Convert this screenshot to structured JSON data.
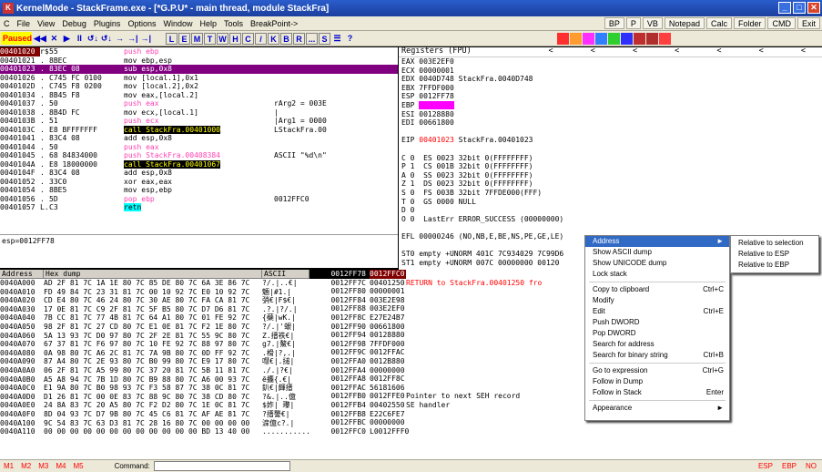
{
  "window": {
    "title": "KernelMode - StackFrame.exe - [*G.P.U* - main thread, module StackFra]",
    "min": "_",
    "max": "□",
    "close": "✕"
  },
  "menu": {
    "items": [
      "C",
      "File",
      "View",
      "Debug",
      "Plugins",
      "Options",
      "Window",
      "Help",
      "Tools",
      "BreakPoint->"
    ],
    "right": [
      "BP",
      "P",
      "VB",
      "Notepad",
      "Calc",
      "Folder",
      "CMD",
      "Exit"
    ]
  },
  "toolbar": {
    "status": "Paused",
    "buttons": [
      "◀◀",
      "✕",
      "▶",
      "II",
      "↺↓",
      "↺↓",
      "→",
      "→|",
      "→|"
    ],
    "letters": [
      "L",
      "E",
      "M",
      "T",
      "W",
      "H",
      "C",
      "/",
      "K",
      "B",
      "R",
      "...",
      "S"
    ],
    "extra": [
      "☰",
      "?"
    ]
  },
  "disasm": {
    "rows": [
      {
        "addr": "00401020",
        "mark": "r$",
        "bytes": "55",
        "instr": "push ebp",
        "kind": "push",
        "comment": ""
      },
      {
        "addr": "00401021",
        "mark": ".",
        "bytes": "8BEC",
        "instr": "mov ebp,esp",
        "kind": "mov",
        "comment": ""
      },
      {
        "addr": "00401023",
        "mark": ".",
        "bytes": "83EC 08",
        "instr": "sub esp,0x8",
        "kind": "cur",
        "comment": ""
      },
      {
        "addr": "00401026",
        "mark": ".",
        "bytes": "C745 FC 0100",
        "instr": "mov [local.1],0x1",
        "kind": "mov",
        "comment": ""
      },
      {
        "addr": "0040102D",
        "mark": ".",
        "bytes": "C745 F8 0200",
        "instr": "mov [local.2],0x2",
        "kind": "mov",
        "comment": ""
      },
      {
        "addr": "00401034",
        "mark": ".",
        "bytes": "8B45 F8",
        "instr": "mov eax,[local.2]",
        "kind": "mov",
        "comment": ""
      },
      {
        "addr": "00401037",
        "mark": ".",
        "bytes": "50",
        "instr": "push eax",
        "kind": "push",
        "comment": "rArg2 = 003E"
      },
      {
        "addr": "00401038",
        "mark": ".",
        "bytes": "8B4D FC",
        "instr": "mov ecx,[local.1]",
        "kind": "mov",
        "comment": "|"
      },
      {
        "addr": "0040103B",
        "mark": ".",
        "bytes": "51",
        "instr": "push ecx",
        "kind": "push",
        "comment": "|Arg1 = 0000"
      },
      {
        "addr": "0040103C",
        "mark": ".",
        "bytes": "E8 BFFFFFFF",
        "instr": "call StackFra.00401000",
        "kind": "call",
        "comment": "LStackFra.00"
      },
      {
        "addr": "00401041",
        "mark": ".",
        "bytes": "83C4 08",
        "instr": "add esp,0x8",
        "kind": "mov",
        "comment": ""
      },
      {
        "addr": "00401044",
        "mark": ".",
        "bytes": "50",
        "instr": "push eax",
        "kind": "push",
        "comment": ""
      },
      {
        "addr": "00401045",
        "mark": ".",
        "bytes": "68 84834000",
        "instr": "push StackFra.00408384",
        "kind": "push",
        "comment": "ASCII \"%d\\n\""
      },
      {
        "addr": "0040104A",
        "mark": ".",
        "bytes": "E8 18000000",
        "instr": "call StackFra.00401067",
        "kind": "call",
        "comment": ""
      },
      {
        "addr": "0040104F",
        "mark": ".",
        "bytes": "83C4 08",
        "instr": "add esp,0x8",
        "kind": "mov",
        "comment": ""
      },
      {
        "addr": "00401052",
        "mark": ".",
        "bytes": "33C0",
        "instr": "xor eax,eax",
        "kind": "mov",
        "comment": ""
      },
      {
        "addr": "00401054",
        "mark": ".",
        "bytes": "8BE5",
        "instr": "mov esp,ebp",
        "kind": "mov",
        "comment": ""
      },
      {
        "addr": "00401056",
        "mark": ".",
        "bytes": "5D",
        "instr": "pop ebp",
        "kind": "push",
        "comment": "0012FFC0"
      },
      {
        "addr": "00401057",
        "mark": "L.",
        "bytes": "C3",
        "instr": "retn",
        "kind": "ret",
        "comment": ""
      }
    ]
  },
  "esp_info": "esp=0012FF78",
  "registers": {
    "header": "Registers (FPU)",
    "arrows": "< < < < < < <",
    "rows": [
      {
        "t": "EAX 003E2EF0"
      },
      {
        "t": "ECX 00000001"
      },
      {
        "t": "EDX 0040D748 StackFra.0040D748"
      },
      {
        "t": "EBX 7FFDF000"
      },
      {
        "t": "ESP 0012FF78"
      },
      {
        "t": "EBP ",
        "hl": "0012FF78"
      },
      {
        "t": "ESI 00128880"
      },
      {
        "t": "EDI 00661800"
      },
      {
        "t": ""
      },
      {
        "t": "EIP ",
        "red": "00401023",
        "rest": " StackFra.00401023"
      },
      {
        "t": ""
      },
      {
        "t": "C 0  ES 0023 32bit 0(FFFFFFFF)"
      },
      {
        "t": "P 1  CS 001B 32bit 0(FFFFFFFF)"
      },
      {
        "t": "A 0  SS 0023 32bit 0(FFFFFFFF)"
      },
      {
        "t": "Z 1  DS 0023 32bit 0(FFFFFFFF)"
      },
      {
        "t": "S 0  FS 003B 32bit 7FFDE000(FFF)"
      },
      {
        "t": "T 0  GS 0000 NULL"
      },
      {
        "t": "D 0"
      },
      {
        "t": "O 0  LastErr ERROR_SUCCESS (00000000)"
      },
      {
        "t": ""
      },
      {
        "t": "EFL 00000246 (NO,NB,E,BE,NS,PE,GE,LE)"
      },
      {
        "t": ""
      },
      {
        "t": "ST0 empty +UNORM 401C 7C934029 7C99D6"
      },
      {
        "t": "ST1 empty +UNORM 007C 00000000 00120"
      }
    ]
  },
  "dump": {
    "headers": [
      "Address",
      "Hex dump",
      "ASCII"
    ],
    "rows": [
      {
        "a": "0040A000",
        "h": "AD 2F 81 7C 1A 1E 80 7C 85 DE 80 7C 6A 3E 86 7C",
        "s": "?/.|..€|"
      },
      {
        "a": "0040A010",
        "h": "FD 49 84 7C 23 31 81 7C 00 10 92 7C E0 10 92 7C",
        "s": "魎|#1.|"
      },
      {
        "a": "0040A020",
        "h": "CD E4 80 7C 46 24 80 7C 30 AE 80 7C FA CA 81 7C",
        "s": "弰€|F$€|"
      },
      {
        "a": "0040A030",
        "h": "17 0E 81 7C C9 2F 81 7C 5F B5 80 7C D7 D6 81 7C",
        "s": ".?.|?/.|"
      },
      {
        "a": "0040A040",
        "h": "7B CC 81 7C 77 4B 81 7C 64 A1 80 7C 01 FE 92 7C",
        "s": "{蘗|wK.|"
      },
      {
        "a": "0040A050",
        "h": "98 2F 81 7C 27 CD 80 7C E1 0E 81 7C F2 1E 80 7C",
        "s": "?/.|'蛝|"
      },
      {
        "a": "0040A060",
        "h": "5A 13 93 7C D0 97 80 7C 2F 2E 81 7C 55 9C 80 7C",
        "s": "Z.搢袟€|"
      },
      {
        "a": "0040A070",
        "h": "67 37 81 7C F6 97 80 7C 10 FE 92 7C 88 97 80 7C",
        "s": "g7.|鰲€|"
      },
      {
        "a": "0040A080",
        "h": "0A 98 80 7C A6 2C 81 7C 7A 9B 80 7C 0D FF 92 7C",
        "s": ".榾|?,.|"
      },
      {
        "a": "0040A090",
        "h": "87 A4 80 7C 2E 93 80 7C B0 99 80 7C E9 17 80 7C",
        "s": "嚖€|.搥|"
      },
      {
        "a": "0040A0A0",
        "h": "06 2F 81 7C A5 99 80 7C 37 20 81 7C 5B 11 81 7C",
        "s": "./.|?€|"
      },
      {
        "a": "0040A0B0",
        "h": "A5 A8 94 7C 7B 1D 80 7C B9 88 80 7C A6 00 93 7C",
        "s": "ē攟{.€|"
      },
      {
        "a": "0040A0C0",
        "h": "E1 9A 80 7C B0 98 93 7C F3 58 87 7C 38 0C 81 7C",
        "s": "釟€|皹搢"
      },
      {
        "a": "0040A0D0",
        "h": "D1 26 81 7C 00 0E 83 7C 88 9C 80 7C 38 CD 80 7C",
        "s": "?&.|..億"
      },
      {
        "a": "0040A0E0",
        "h": "24 8A 83 7C 20 A5 80 7C F2 D2 80 7C 1E 0C 81 7C",
        "s": "$妰| 瓈|"
      },
      {
        "a": "0040A0F0",
        "h": "8D 04 93 7C D7 9B 80 7C 45 C6 81 7C AF AE 81 7C",
        "s": "?搢讋€|"
      },
      {
        "a": "0040A100",
        "h": "9C 54 83 7C 63 D3 81 7C 28 16 80 7C 00 00 00 00",
        "s": "淭億c?.|"
      },
      {
        "a": "0040A110",
        "h": "00 00 00 00 00 00 00 00 00 00 00 00 BD 13 40 00",
        "s": "............"
      }
    ]
  },
  "stack": {
    "rows": [
      {
        "a": "0012FF78",
        "v": "0012FFC0",
        "c": "",
        "top": true
      },
      {
        "a": "0012FF7C",
        "v": "00401250",
        "c": "RETURN to StackFra.00401250 fro",
        "red": true
      },
      {
        "a": "0012FF80",
        "v": "00000001",
        "c": ""
      },
      {
        "a": "0012FF84",
        "v": "003E2E98",
        "c": ""
      },
      {
        "a": "0012FF88",
        "v": "003E2EF0",
        "c": ""
      },
      {
        "a": "0012FF8C",
        "v": "E27E24B7",
        "c": ""
      },
      {
        "a": "0012FF90",
        "v": "00661800",
        "c": ""
      },
      {
        "a": "0012FF94",
        "v": "00128880",
        "c": ""
      },
      {
        "a": "0012FF98",
        "v": "7FFDF000",
        "c": ""
      },
      {
        "a": "0012FF9C",
        "v": "0012FFAC",
        "c": ""
      },
      {
        "a": "0012FFA0",
        "v": "0012B880",
        "c": ""
      },
      {
        "a": "0012FFA4",
        "v": "00000000",
        "c": ""
      },
      {
        "a": "0012FFA8",
        "v": "0012FF8C",
        "c": ""
      },
      {
        "a": "0012FFAC",
        "v": "56181606",
        "c": ""
      },
      {
        "a": "0012FFB0",
        "v": "0012FFE0",
        "c": "Pointer to next SEH record"
      },
      {
        "a": "0012FFB4",
        "v": "00402550",
        "c": "SE handler"
      },
      {
        "a": "0012FFB8",
        "v": "E22C6FE7",
        "c": ""
      },
      {
        "a": "0012FFBC",
        "v": "00000000",
        "c": ""
      },
      {
        "a": "0012FFC0",
        "v": "L0012FFF0",
        "c": ""
      }
    ]
  },
  "context_menu": {
    "items": [
      {
        "label": "Address",
        "key": "►",
        "active": true
      },
      {
        "label": "Show ASCII dump",
        "key": ""
      },
      {
        "label": "Show UNICODE dump",
        "key": ""
      },
      {
        "label": "Lock stack",
        "key": ""
      },
      {
        "sep": true
      },
      {
        "label": "Copy to clipboard",
        "key": "Ctrl+C"
      },
      {
        "label": "Modify",
        "key": ""
      },
      {
        "label": "Edit",
        "key": "Ctrl+E"
      },
      {
        "label": "Push DWORD",
        "key": ""
      },
      {
        "label": "Pop DWORD",
        "key": ""
      },
      {
        "label": "Search for address",
        "key": ""
      },
      {
        "label": "Search for binary string",
        "key": "Ctrl+B"
      },
      {
        "sep": true
      },
      {
        "label": "Go to expression",
        "key": "Ctrl+G"
      },
      {
        "label": "Follow in Dump",
        "key": ""
      },
      {
        "label": "Follow in Stack",
        "key": "Enter"
      },
      {
        "sep": true
      },
      {
        "label": "Appearance",
        "key": "►"
      }
    ]
  },
  "submenu": {
    "items": [
      "Relative to selection",
      "Relative to ESP",
      "Relative to EBP"
    ]
  },
  "status": {
    "markers": [
      "M1",
      "M2",
      "M3",
      "M4",
      "M5"
    ],
    "cmd_label": "Command:",
    "right": [
      "ESP",
      "EBP",
      "NO"
    ]
  }
}
